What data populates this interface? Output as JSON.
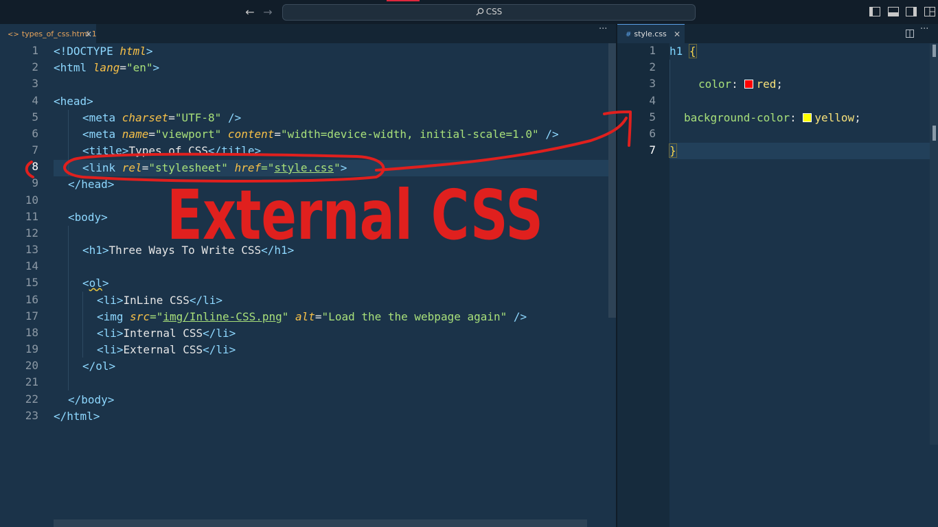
{
  "title_bar": {
    "search_text": "CSS"
  },
  "left_pane": {
    "tab": {
      "filename": "types_of_css.html",
      "problem_count": "1",
      "icon": "html-code-icon"
    },
    "more_label": "···",
    "line_numbers": [
      "1",
      "2",
      "3",
      "4",
      "5",
      "6",
      "7",
      "8",
      "9",
      "10",
      "11",
      "12",
      "13",
      "14",
      "15",
      "16",
      "17",
      "18",
      "19",
      "20",
      "21",
      "22",
      "23"
    ],
    "active_line": "8",
    "code": {
      "l1": {
        "open": "<!DOCTYPE ",
        "kw": "html",
        "close": ">"
      },
      "l2": {
        "open": "<html ",
        "attr": "lang",
        "eq": "=",
        "val": "\"en\"",
        "close": ">"
      },
      "l4": {
        "tag": "<head>"
      },
      "l5": {
        "open": "<meta ",
        "attr": "charset",
        "eq": "=",
        "val": "\"UTF-8\"",
        "close": " />"
      },
      "l6": {
        "open": "<meta ",
        "attr1": "name",
        "eq1": "=",
        "val1": "\"viewport\"",
        "attr2": " content",
        "eq2": "=",
        "val2": "\"width=device-width, initial-scale=1.0\"",
        "close": " />"
      },
      "l7": {
        "open": "<title>",
        "text": "Types of CSS",
        "close": "</title>"
      },
      "l8": {
        "open": "<link ",
        "attr1": "rel",
        "eq1": "=",
        "val1": "\"stylesheet\"",
        "attr2": " href",
        "eq2": "=\"",
        "val2": "style.css",
        "q": "\"",
        "close": ">"
      },
      "l9": {
        "tag": "</head>"
      },
      "l11": {
        "tag": "<body>"
      },
      "l13": {
        "open": "<h1>",
        "text": "Three Ways To Write CSS",
        "close": "</h1>"
      },
      "l15": {
        "open": "<",
        "name": "ol",
        "close": ">"
      },
      "l16": {
        "open": "<li>",
        "text": "InLine CSS",
        "close": "</li>"
      },
      "l17": {
        "open": "<img ",
        "attr1": "src",
        "eq1": "=\"",
        "val1": "img/Inline-CSS.png",
        "q1": "\"",
        "attr2": " alt",
        "eq2": "=",
        "val2": "\"Load the the webpage again\"",
        "close": " />"
      },
      "l18": {
        "open": "<li>",
        "text": "Internal CSS",
        "close": "</li>"
      },
      "l19": {
        "open": "<li>",
        "text": "External CSS",
        "close": "</li>"
      },
      "l20": {
        "tag": "</ol>"
      },
      "l22": {
        "tag": "</body>"
      },
      "l23": {
        "tag": "</html>"
      }
    }
  },
  "right_pane": {
    "tab": {
      "filename": "style.css",
      "icon": "css-hash-icon",
      "icon_glyph": "#"
    },
    "line_numbers": [
      "1",
      "2",
      "3",
      "4",
      "5",
      "6",
      "7"
    ],
    "active_line": "7",
    "code": {
      "l1": {
        "sel": "h1 ",
        "brace": "{"
      },
      "l3": {
        "prop": "color",
        "colon": ": ",
        "val": "red",
        "semi": ";",
        "swatch": "#ff0000"
      },
      "l5": {
        "prop": "background-color",
        "colon": ": ",
        "val": "yellow",
        "semi": ";",
        "swatch": "#ffff00"
      },
      "l7": {
        "brace": "}"
      }
    }
  },
  "annotation": {
    "text": "External CSS",
    "color": "#e0201e"
  }
}
